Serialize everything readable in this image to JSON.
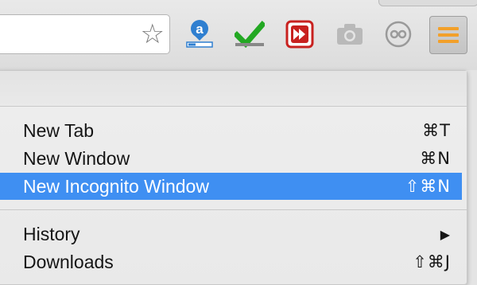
{
  "toolbar": {
    "bookmark_icon": "star-icon",
    "extensions": [
      {
        "name": "amazon-assistant-icon",
        "glyph": "a"
      },
      {
        "name": "checkmark-extension-icon",
        "glyph": "✔"
      },
      {
        "name": "fast-forward-extension-icon",
        "glyph": "⏩"
      },
      {
        "name": "camera-extension-icon",
        "glyph": ""
      },
      {
        "name": "infinity-extension-icon",
        "glyph": "∞"
      }
    ],
    "menu_icon": "hamburger-menu-icon",
    "menu_icon_color": "#f2a02a"
  },
  "menu": {
    "items": [
      {
        "label": "New Tab",
        "shortcut": "⌘T"
      },
      {
        "label": "New Window",
        "shortcut": "⌘N"
      },
      {
        "label": "New Incognito Window",
        "shortcut": "⇧⌘N",
        "selected": true
      },
      {
        "label": "History",
        "shortcut": "▶"
      },
      {
        "label": "Downloads",
        "shortcut": "⇧⌘J"
      }
    ],
    "selected_color": "#3f8ff2"
  }
}
